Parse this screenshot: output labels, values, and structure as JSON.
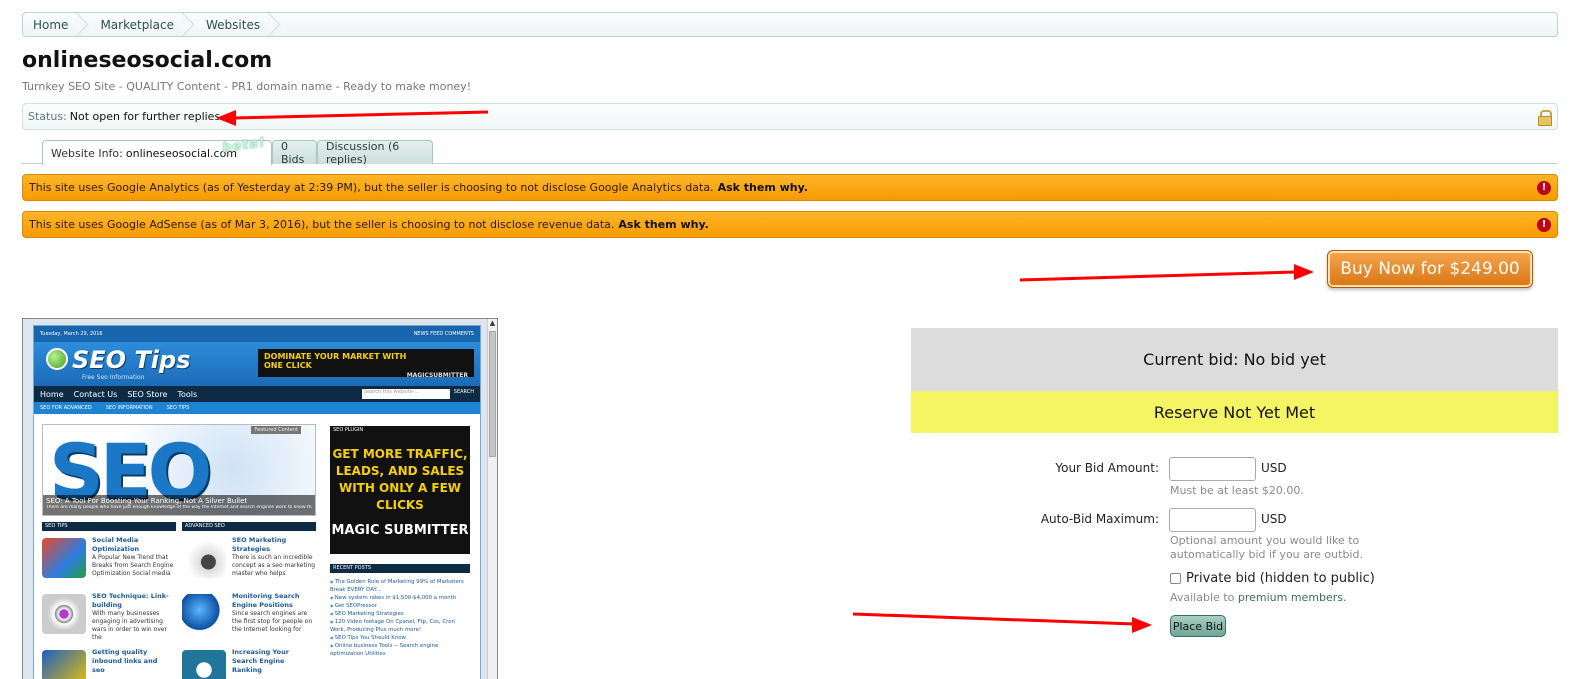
{
  "breadcrumb": [
    "Home",
    "Marketplace",
    "Websites"
  ],
  "listing": {
    "title": "onlineseosocial.com",
    "subtitle": "Turnkey SEO Site - QUALITY Content - PR1 domain name - Ready to make money!"
  },
  "status": {
    "label": "Status:",
    "text": "Not open for further replies."
  },
  "tabs": {
    "website_info_prefix": "Website Info:",
    "website_info_domain": "onlineseosocial.com",
    "beta": "beta!",
    "bids": "0 Bids",
    "discussion": "Discussion (6 replies)"
  },
  "notices": [
    {
      "text": "This site uses Google Analytics (as of Yesterday at 2:39 PM), but the seller is choosing to not disclose Google Analytics data.",
      "link": "Ask them why."
    },
    {
      "text": "This site uses Google AdSense (as of Mar 3, 2016), but the seller is choosing to not disclose revenue data.",
      "link": "Ask them why."
    }
  ],
  "buy_now": "Buy Now for $249.00",
  "bid": {
    "current": "Current bid: No bid yet",
    "reserve": "Reserve Not Yet Met",
    "amount_label": "Your Bid Amount:",
    "currency": "USD",
    "amount_hint": "Must be at least $20.00.",
    "autobid_label": "Auto-Bid Maximum:",
    "autobid_hint_1": "Optional amount you would like to",
    "autobid_hint_2": "automatically bid if you are outbid.",
    "private_label": "Private bid (hidden to public)",
    "private_hint_prefix": "Available to",
    "private_hint_link": "premium members.",
    "place_bid": "Place Bid"
  },
  "preview": {
    "date": "Tuesday, March 29, 2016",
    "feeds": "NEWS FEED   COMMENTS",
    "logo": "SEO Tips",
    "logo_sub": "Free Seo Information",
    "ad_line1": "DOMINATE YOUR MARKET WITH",
    "ad_line2": "ONE CLICK",
    "ad_brand": "MAGICSUBMITTER",
    "nav": [
      "Home",
      "Contact Us",
      "SEO Store",
      "Tools"
    ],
    "search_placeholder": "Search this website ...",
    "search_btn": "SEARCH",
    "subnav": [
      "SEO FOR ADVANCED",
      "SEO INFORMATION",
      "SEO TIPS"
    ],
    "feature_tag": "Featured Content",
    "feature_word": "SEO",
    "feature_caption": "SEO: A Tool For Boosting Your Ranking, Not A Silver Bullet",
    "feature_desc": "There are many people who have just enough knowledge of the way the Internet and search engines work to know that",
    "col1_head": "SEO TIPS",
    "col2_head": "ADVANCED SEO",
    "posts": [
      {
        "title": "Social Media Optimization",
        "desc": "A Popular New Trend that Breaks from Search Engine Optimization Social media"
      },
      {
        "title": "SEO Marketing Strategies",
        "desc": "There is such an incredible concept as a seo marketing master who helps"
      },
      {
        "title": "SEO Technique: Link-building",
        "desc": "With many businesses engaging in advertising wars in order to win over the"
      },
      {
        "title": "Monitoring Search Engine Positions",
        "desc": "Since search engines are the first stop for people on the Internet looking for"
      },
      {
        "title": "Getting quality inbound links and seo",
        "desc": ""
      },
      {
        "title": "Increasing Your Search Engine Ranking",
        "desc": ""
      }
    ],
    "side_head": "SEO PLUGIN",
    "side_ad": "GET MORE TRAFFIC, LEADS, AND SALES WITH ONLY A FEW CLICKS",
    "side_ad_brand": "MAGIC SUBMITTER",
    "recent_head": "RECENT POSTS",
    "recent": [
      "The Golden Rule of Marketing 99% of Marketers Break EVERY DAY...",
      "New system rakes in $1,500-$4,000 a month",
      "Get SEOPressor",
      "SEO Marketing Strategies",
      "120 Video footage On Cpanel, Ftp, Css, Cron Work, Producing Plus much more!",
      "SEO Tips You Should Know",
      "Online business Tools -- Search engine optimization Utilities"
    ]
  },
  "colors": {
    "accent": "#f59b00",
    "annotation": "#ff0000",
    "reserve_bg": "#f5f563"
  }
}
